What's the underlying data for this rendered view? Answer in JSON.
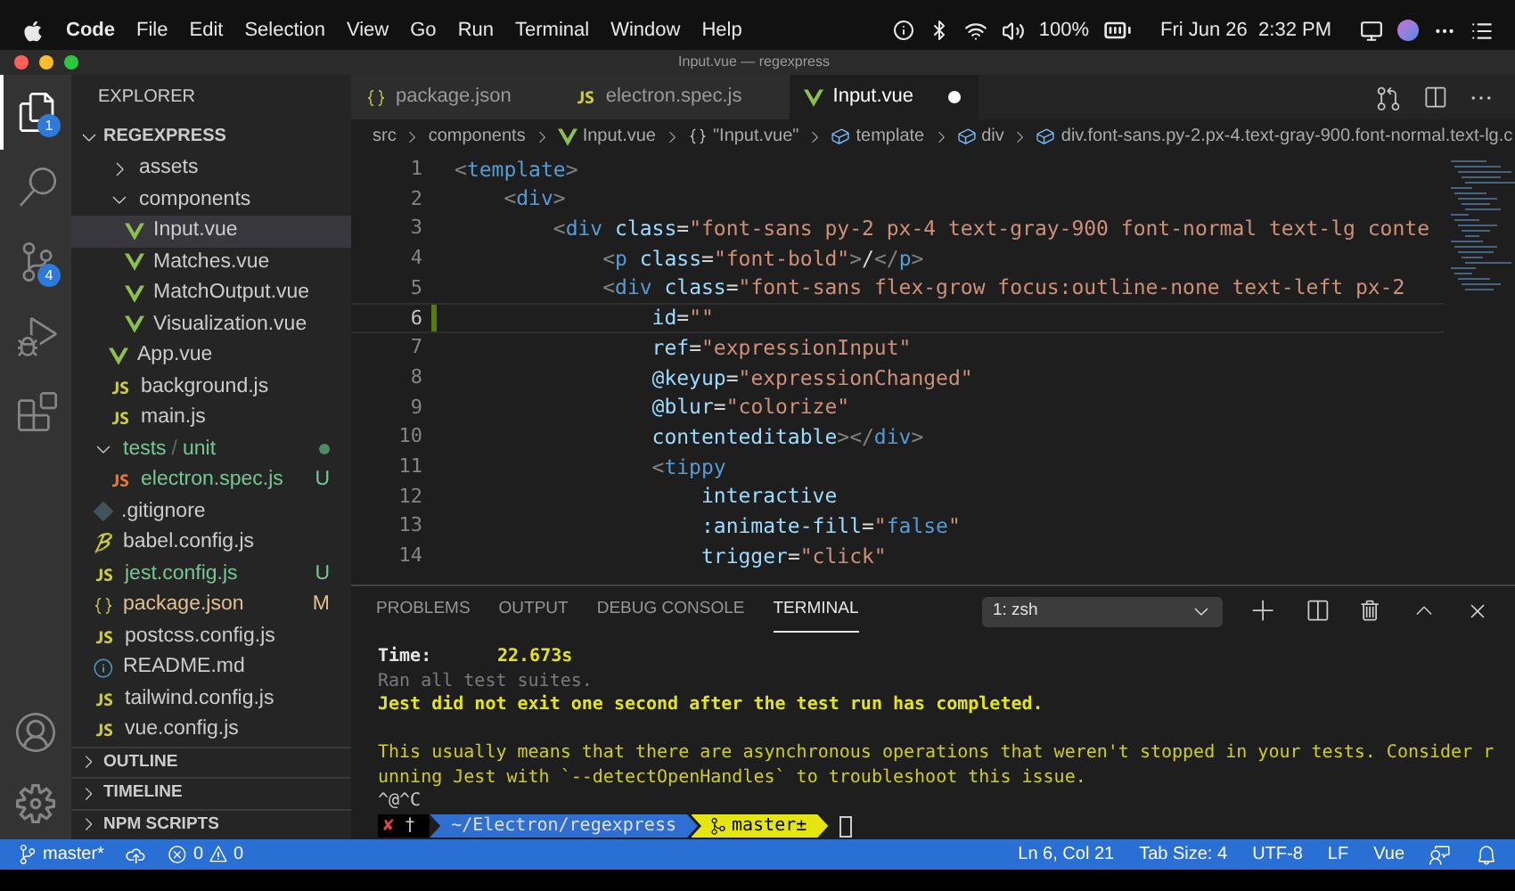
{
  "menubar": {
    "app_name": "Code",
    "menus": [
      "File",
      "Edit",
      "Selection",
      "View",
      "Go",
      "Run",
      "Terminal",
      "Window",
      "Help"
    ],
    "battery": "100%",
    "clock": "Fri Jun 26  2:32 PM"
  },
  "window": {
    "title": "Input.vue — regexpress"
  },
  "activity_bar": {
    "items": [
      {
        "kind": "explorer",
        "selected": true,
        "badge": "1"
      },
      {
        "kind": "search",
        "selected": false
      },
      {
        "kind": "source_control",
        "selected": false,
        "badge": "4"
      },
      {
        "kind": "run",
        "selected": false
      },
      {
        "kind": "extensions",
        "selected": false
      }
    ]
  },
  "sidebar": {
    "title": "EXPLORER",
    "root": "REGEXPRESS",
    "tree": [
      {
        "kind": "group",
        "children": [
          {
            "kind": "folder",
            "name": "assets",
            "expanded": false,
            "selected": false,
            "untracked": false,
            "modified": false
          },
          {
            "kind": "folder",
            "name": "components",
            "expanded": true,
            "selected": false,
            "untracked": false,
            "modified": false,
            "children": [
              {
                "kind": "vue",
                "name": "Input.vue",
                "selected": true,
                "untracked": false,
                "modified": false
              },
              {
                "kind": "vue",
                "name": "Matches.vue",
                "selected": false,
                "untracked": false,
                "modified": false
              },
              {
                "kind": "vue",
                "name": "MatchOutput.vue",
                "selected": false,
                "untracked": false,
                "modified": false
              },
              {
                "kind": "vue",
                "name": "Visualization.vue",
                "selected": false,
                "untracked": false,
                "modified": false
              }
            ]
          },
          {
            "kind": "vue",
            "name": "App.vue",
            "selected": false,
            "untracked": false,
            "modified": false
          },
          {
            "kind": "js",
            "name": "background.js",
            "selected": false,
            "untracked": false,
            "modified": false
          },
          {
            "kind": "js",
            "name": "main.js",
            "selected": false,
            "untracked": false,
            "modified": false
          }
        ]
      },
      {
        "kind": "folder",
        "name": "tests",
        "separator": "/",
        "name_suffix": "unit",
        "expanded": true,
        "selected": false,
        "untracked": true,
        "modified": false,
        "children": [
          {
            "kind": "jsspec",
            "name": "electron.spec.js",
            "selected": false,
            "untracked": true,
            "modified": false,
            "badge": "U"
          }
        ]
      },
      {
        "kind": "git",
        "name": ".gitignore",
        "selected": false,
        "untracked": false,
        "modified": false
      },
      {
        "kind": "babel",
        "name": "babel.config.js",
        "selected": false,
        "untracked": false,
        "modified": false
      },
      {
        "kind": "js",
        "name": "jest.config.js",
        "selected": false,
        "untracked": true,
        "modified": false,
        "badge": "U"
      },
      {
        "kind": "json",
        "name": "package.json",
        "selected": false,
        "untracked": false,
        "modified": true,
        "badge": "M"
      },
      {
        "kind": "js",
        "name": "postcss.config.js",
        "selected": false,
        "untracked": false,
        "modified": false
      },
      {
        "kind": "info",
        "name": "README.md",
        "selected": false,
        "untracked": false,
        "modified": false
      },
      {
        "kind": "js",
        "name": "tailwind.config.js",
        "selected": false,
        "untracked": false,
        "modified": false
      },
      {
        "kind": "js",
        "name": "vue.config.js",
        "selected": false,
        "untracked": false,
        "modified": false
      }
    ],
    "sections": [
      "OUTLINE",
      "TIMELINE",
      "NPM SCRIPTS"
    ]
  },
  "tabs": [
    {
      "kind": "json",
      "label": "package.json",
      "selected": false,
      "dirty": false
    },
    {
      "kind": "js",
      "label": "electron.spec.js",
      "selected": false,
      "dirty": false
    },
    {
      "kind": "vue",
      "label": "Input.vue",
      "selected": true,
      "dirty": true
    }
  ],
  "breadcrumb": [
    {
      "kind": "folder",
      "text": "src"
    },
    {
      "kind": "folder",
      "text": "components"
    },
    {
      "kind": "vue",
      "text": "Input.vue"
    },
    {
      "kind": "module",
      "text": "\"Input.vue\""
    },
    {
      "kind": "element",
      "text": "template"
    },
    {
      "kind": "element",
      "text": "div"
    },
    {
      "kind": "element",
      "text": "div.font-sans.py-2.px-4.text-gray-900.font-normal.text-lg.c"
    }
  ],
  "code": [
    {
      "number": "1",
      "current": false,
      "modified": false,
      "tokens": [
        {
          "kind": "bracket",
          "text": "<"
        },
        {
          "kind": "tag",
          "text": "template"
        },
        {
          "kind": "bracket",
          "text": ">"
        }
      ]
    },
    {
      "number": "2",
      "current": false,
      "modified": false,
      "tokens": [
        {
          "kind": "bracket",
          "text": "    <"
        },
        {
          "kind": "tag",
          "text": "div"
        },
        {
          "kind": "bracket",
          "text": ">"
        }
      ]
    },
    {
      "number": "3",
      "current": false,
      "modified": false,
      "tokens": [
        {
          "kind": "bracket",
          "text": "        <"
        },
        {
          "kind": "tag",
          "text": "div"
        },
        {
          "kind": "attr",
          "text": " class"
        },
        {
          "kind": "punct",
          "text": "="
        },
        {
          "kind": "string",
          "text": "\"font-sans py-2 px-4 text-gray-900 font-normal text-lg conte"
        }
      ]
    },
    {
      "number": "4",
      "current": false,
      "modified": false,
      "tokens": [
        {
          "kind": "bracket",
          "text": "            <"
        },
        {
          "kind": "tag",
          "text": "p"
        },
        {
          "kind": "attr",
          "text": " class"
        },
        {
          "kind": "punct",
          "text": "="
        },
        {
          "kind": "string",
          "text": "\"font-bold\""
        },
        {
          "kind": "bracket",
          "text": ">"
        },
        {
          "kind": "punct",
          "text": "/"
        },
        {
          "kind": "bracket",
          "text": "</"
        },
        {
          "kind": "tag",
          "text": "p"
        },
        {
          "kind": "bracket",
          "text": ">"
        }
      ]
    },
    {
      "number": "5",
      "current": false,
      "modified": false,
      "tokens": [
        {
          "kind": "bracket",
          "text": "            <"
        },
        {
          "kind": "tag",
          "text": "div"
        },
        {
          "kind": "attr",
          "text": " class"
        },
        {
          "kind": "punct",
          "text": "="
        },
        {
          "kind": "string",
          "text": "\"font-sans flex-grow focus:outline-none text-left px-2"
        }
      ]
    },
    {
      "number": "6",
      "current": true,
      "modified": true,
      "tokens": [
        {
          "kind": "attr",
          "text": "                id"
        },
        {
          "kind": "punct",
          "text": "="
        },
        {
          "kind": "string",
          "text": "\"\""
        }
      ]
    },
    {
      "number": "7",
      "current": false,
      "modified": false,
      "tokens": [
        {
          "kind": "attr",
          "text": "                ref"
        },
        {
          "kind": "punct",
          "text": "="
        },
        {
          "kind": "string",
          "text": "\"expressionInput\""
        }
      ]
    },
    {
      "number": "8",
      "current": false,
      "modified": false,
      "tokens": [
        {
          "kind": "attr",
          "text": "                @keyup"
        },
        {
          "kind": "punct",
          "text": "="
        },
        {
          "kind": "string",
          "text": "\"expressionChanged\""
        }
      ]
    },
    {
      "number": "9",
      "current": false,
      "modified": false,
      "tokens": [
        {
          "kind": "attr",
          "text": "                @blur"
        },
        {
          "kind": "punct",
          "text": "="
        },
        {
          "kind": "string",
          "text": "\"colorize\""
        }
      ]
    },
    {
      "number": "10",
      "current": false,
      "modified": false,
      "tokens": [
        {
          "kind": "attr",
          "text": "                contenteditable"
        },
        {
          "kind": "bracket",
          "text": "></"
        },
        {
          "kind": "tag",
          "text": "div"
        },
        {
          "kind": "bracket",
          "text": ">"
        }
      ]
    },
    {
      "number": "11",
      "current": false,
      "modified": false,
      "tokens": [
        {
          "kind": "bracket",
          "text": "                <"
        },
        {
          "kind": "tag",
          "text": "tippy"
        }
      ]
    },
    {
      "number": "12",
      "current": false,
      "modified": false,
      "tokens": [
        {
          "kind": "attr",
          "text": "                    interactive"
        }
      ]
    },
    {
      "number": "13",
      "current": false,
      "modified": false,
      "tokens": [
        {
          "kind": "attr",
          "text": "                    :animate-fill"
        },
        {
          "kind": "punct",
          "text": "="
        },
        {
          "kind": "string",
          "text": "\""
        },
        {
          "kind": "tag",
          "text": "false"
        },
        {
          "kind": "string",
          "text": "\""
        }
      ]
    },
    {
      "number": "14",
      "current": false,
      "modified": false,
      "tokens": [
        {
          "kind": "attr",
          "text": "                    trigger"
        },
        {
          "kind": "punct",
          "text": "="
        },
        {
          "kind": "string",
          "text": "\"click\""
        }
      ]
    }
  ],
  "panel": {
    "tabs": [
      {
        "label": "PROBLEMS",
        "selected": false
      },
      {
        "label": "OUTPUT",
        "selected": false
      },
      {
        "label": "DEBUG CONSOLE",
        "selected": false
      },
      {
        "label": "TERMINAL",
        "selected": true
      }
    ],
    "shell": "1: zsh",
    "lines": [
      {
        "kind": "stat",
        "label": "Time:",
        "value": "22.673s"
      },
      {
        "kind": "dim",
        "text": "Ran all test suites."
      },
      {
        "kind": "warning",
        "text": "Jest did not exit one second after the test run has completed."
      },
      {
        "kind": "blank"
      },
      {
        "kind": "note",
        "text": "This usually means that there are asynchronous operations that weren't stopped in your tests. Consider r"
      },
      {
        "kind": "note",
        "text": "unning Jest with `--detectOpenHandles` to troubleshoot this issue."
      },
      {
        "kind": "plain",
        "text": "^@^C"
      }
    ],
    "prompt": {
      "status": "✘",
      "symbol": "†",
      "path": "~/Electron/regexpress",
      "branch": "master±"
    }
  },
  "status_bar": {
    "branch": "master*",
    "errors": "0",
    "warnings": "0",
    "items": [
      "Ln 6, Col 21",
      "Tab Size: 4",
      "UTF-8",
      "LF",
      "Vue"
    ]
  }
}
